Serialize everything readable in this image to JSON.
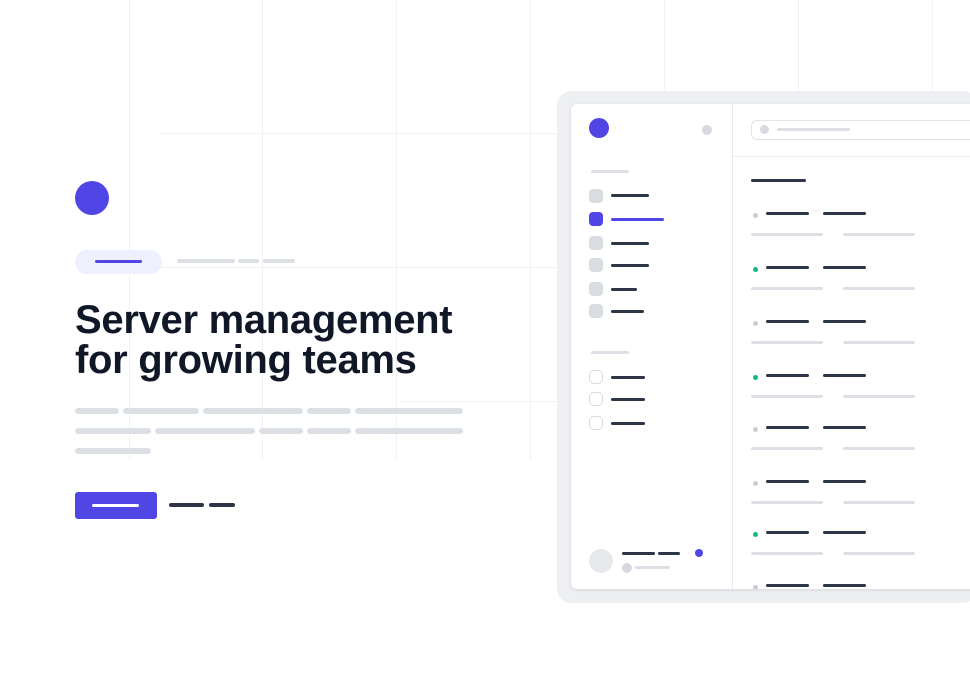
{
  "hero": {
    "headline_line1": "Server management",
    "headline_line2": "for growing teams"
  },
  "colors": {
    "accent": "#4f46e5",
    "heading": "#101828",
    "placeholder": "#dcdfe4",
    "status_online": "#10b981",
    "status_offline": "#c9ccd2"
  },
  "server_list": {
    "statuses": [
      "offline",
      "online",
      "offline",
      "online",
      "offline",
      "offline",
      "online",
      "offline"
    ]
  }
}
